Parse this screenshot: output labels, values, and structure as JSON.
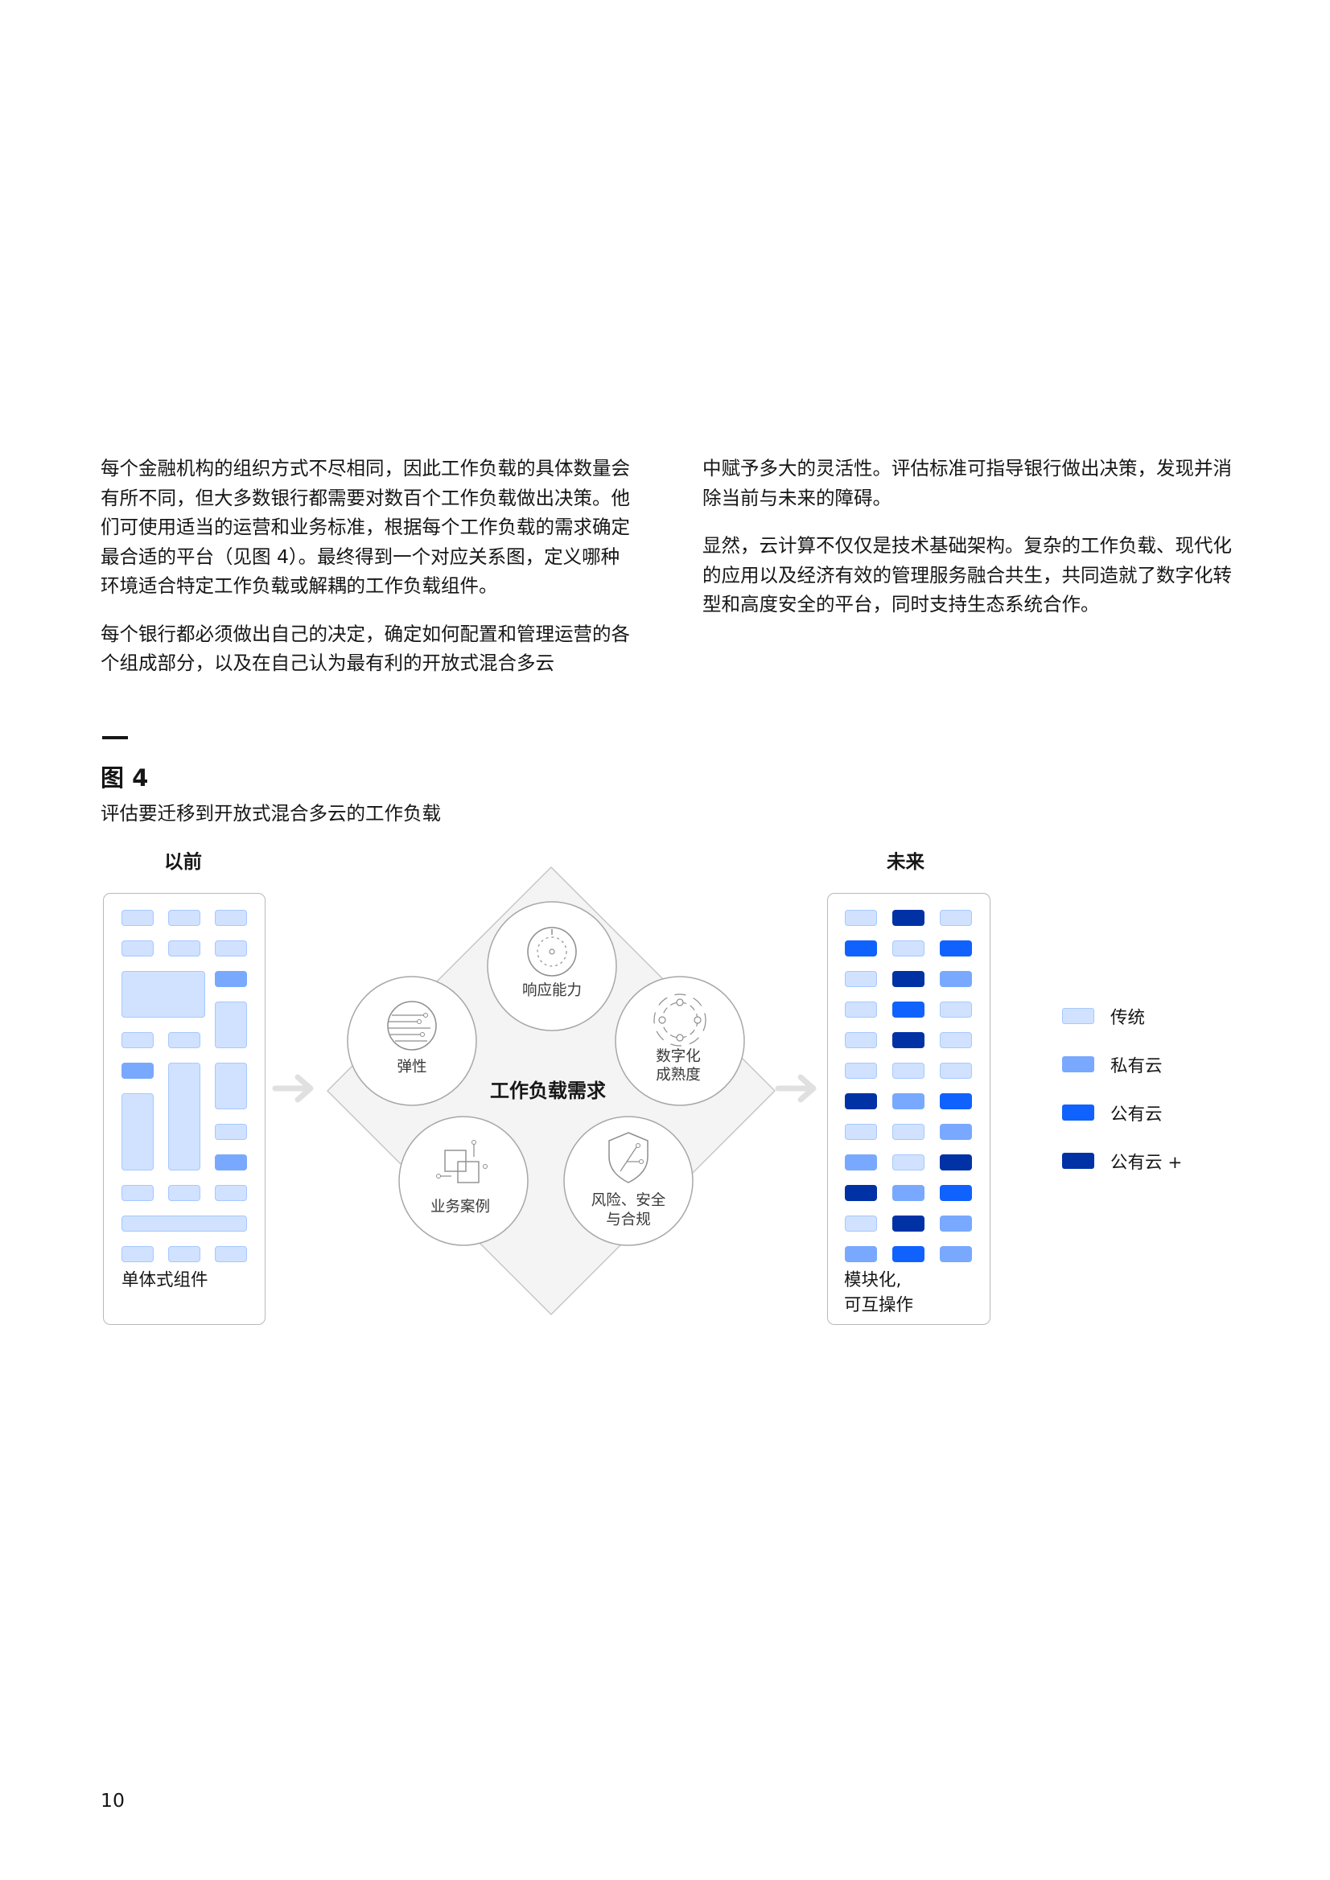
{
  "body": {
    "left_paragraphs": [
      "每个金融机构的组织方式不尽相同，因此工作负载的具体数量会有所不同，但大多数银行都需要对数百个工作负载做出决策。他们可使用适当的运营和业务标准，根据每个工作负载的需求确定最合适的平台（见图 4）。最终得到一个对应关系图，定义哪种环境适合特定工作负载或解耦的工作负载组件。",
      "每个银行都必须做出自己的决定，确定如何配置和管理运营的各个组成部分，以及在自己认为最有利的开放式混合多云"
    ],
    "right_paragraphs": [
      "中赋予多大的灵活性。评估标准可指导银行做出决策，发现并消除当前与未来的障碍。",
      "显然，云计算不仅仅是技术基础架构。复杂的工作负载、现代化的应用以及经济有效的管理服务融合共生，共同造就了数字化转型和高度安全的平台，同时支持生态系统合作。"
    ]
  },
  "figure": {
    "title": "图 4",
    "caption": "评估要迁移到开放式混合多云的工作负载",
    "before": {
      "heading": "以前",
      "label": "单体式组件"
    },
    "future": {
      "heading": "未来",
      "label_line1": "模块化,",
      "label_line2": "可互操作"
    },
    "center": {
      "title": "工作负载需求",
      "circles": {
        "top": "响应能力",
        "left": "弹性",
        "right_line1": "数字化",
        "right_line2": "成熟度",
        "bottom_left": "业务案例",
        "bottom_right_line1": "风险、安全",
        "bottom_right_line2": "与合规"
      }
    },
    "legend": [
      {
        "label": "传统",
        "color": "#d0e2ff"
      },
      {
        "label": "私有云",
        "color": "#78a9ff"
      },
      {
        "label": "公有云",
        "color": "#0f62fe"
      },
      {
        "label": "公有云 +",
        "color": "#0032a6"
      }
    ],
    "future_grid": [
      [
        "c1",
        "c4",
        "c1"
      ],
      [
        "c3",
        "c1",
        "c3"
      ],
      [
        "c1",
        "c4",
        "c2"
      ],
      [
        "c1",
        "c3",
        "c1"
      ],
      [
        "c1",
        "c4",
        "c1"
      ],
      [
        "c1",
        "c1",
        "c1"
      ],
      [
        "c4",
        "c2",
        "c3"
      ],
      [
        "c1",
        "c1",
        "c2"
      ],
      [
        "c2",
        "c1",
        "c4"
      ],
      [
        "c4",
        "c2",
        "c3"
      ],
      [
        "c1",
        "c4",
        "c2"
      ],
      [
        "c2",
        "c3",
        "c2"
      ]
    ]
  },
  "page_number": "10"
}
